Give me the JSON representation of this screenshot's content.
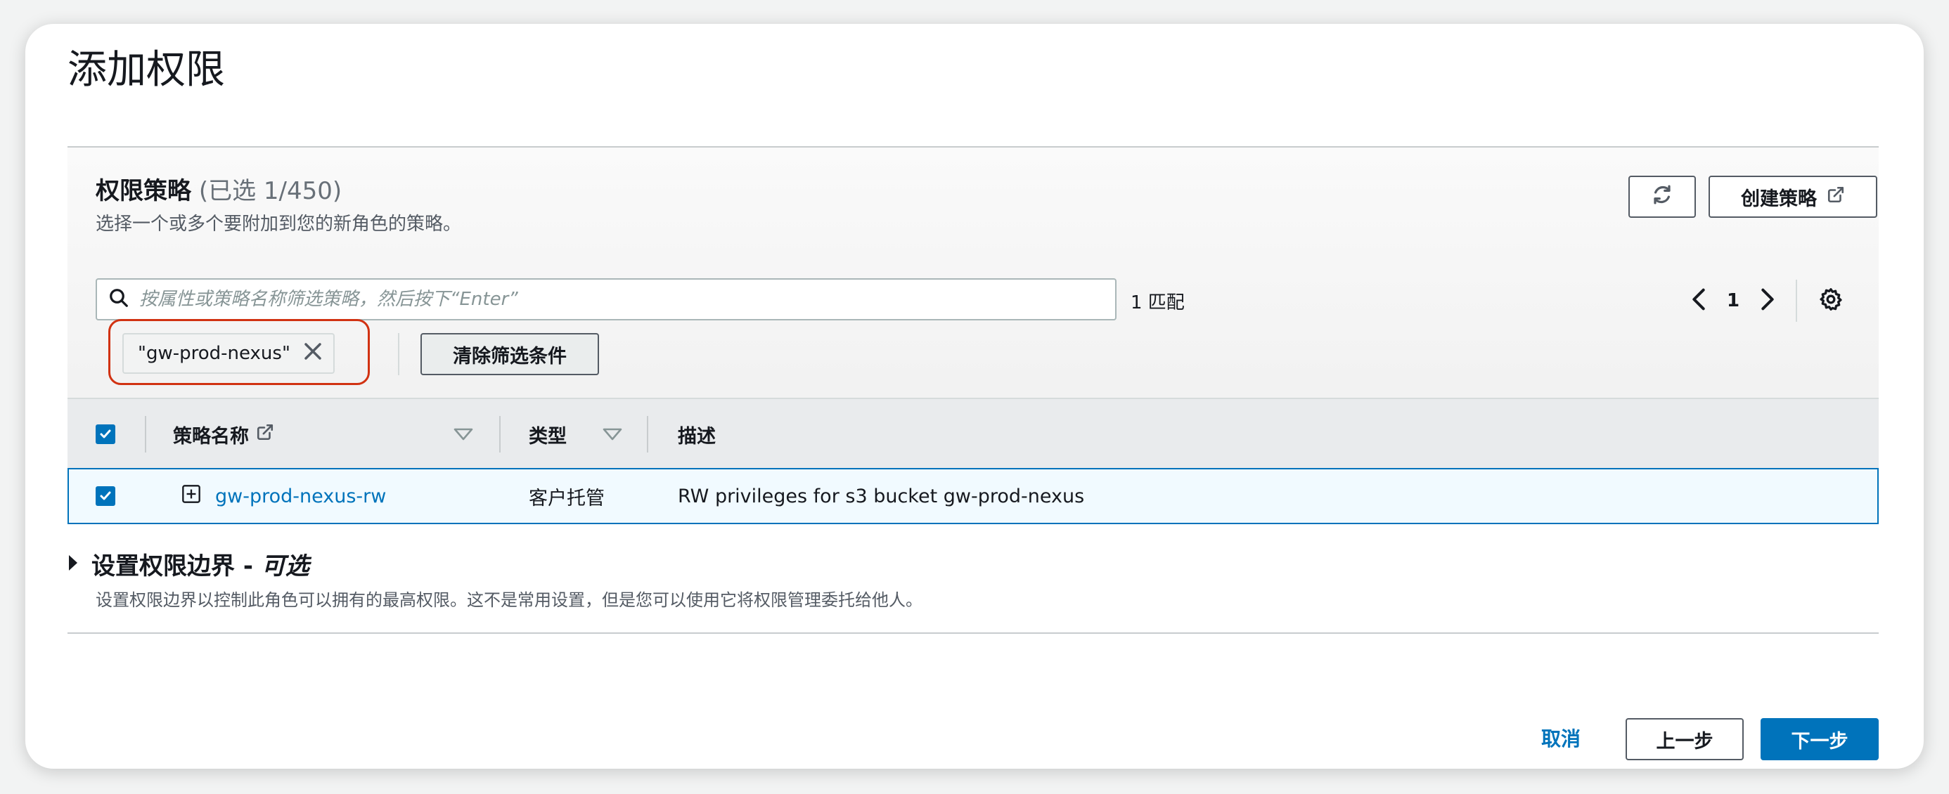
{
  "page": {
    "title": "添加权限"
  },
  "policies_panel": {
    "title": "权限策略",
    "selection_count": "(已选 1/450)",
    "description": "选择一个或多个要附加到您的新角色的策略。",
    "refresh_icon": "refresh-icon",
    "create_policy_label": "创建策略",
    "create_policy_icon": "external-link-icon"
  },
  "filter": {
    "search_placeholder": "按属性或策略名称筛选策略，然后按下“Enter”",
    "search_value": "",
    "match_text": "1 匹配",
    "token_text": "\"gw-prod-nexus\"",
    "clear_filters_label": "清除筛选条件"
  },
  "pagination": {
    "current_page": "1",
    "prev_icon": "chevron-left-icon",
    "next_icon": "chevron-right-icon",
    "settings_icon": "gear-icon"
  },
  "table": {
    "columns": {
      "name": "策略名称",
      "type": "类型",
      "description": "描述"
    },
    "rows": [
      {
        "selected": true,
        "name": "gw-prod-nexus-rw",
        "type": "客户托管",
        "description": "RW privileges for s3 bucket gw-prod-nexus"
      }
    ]
  },
  "permissions_boundary": {
    "title": "设置权限边界 - ",
    "optional": "可选",
    "description": "设置权限边界以控制此角色可以拥有的最高权限。这不是常用设置，但是您可以使用它将权限管理委托给他人。"
  },
  "footer": {
    "cancel_label": "取消",
    "previous_label": "上一步",
    "next_label": "下一步"
  },
  "colors": {
    "accent": "#0073bb",
    "highlight_border": "#d13212",
    "selected_row_bg": "#f1faff"
  }
}
